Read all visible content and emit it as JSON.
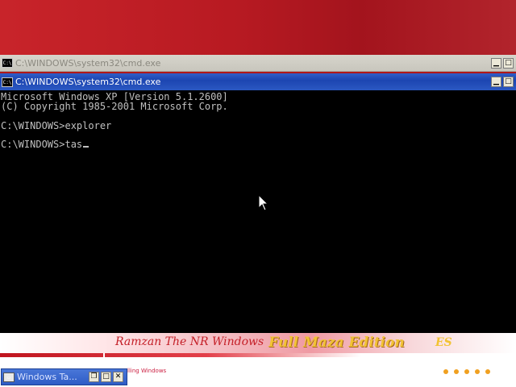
{
  "windows": {
    "background": {
      "title": "C:\\WINDOWS\\system32\\cmd.exe",
      "icon": "console-icon"
    },
    "active": {
      "title": "C:\\WINDOWS\\system32\\cmd.exe",
      "icon": "console-icon"
    }
  },
  "console": {
    "lines": [
      "Microsoft Windows XP [Version 5.1.2600]",
      "(C) Copyright 1985-2001 Microsoft Corp.",
      "",
      "C:\\WINDOWS>explorer",
      "",
      "C:\\WINDOWS>tas"
    ]
  },
  "banner": {
    "title": "Ramzan  The NR  Windows",
    "edition": "Full Maza Edition",
    "tail": "ES",
    "status": "lling Windows"
  },
  "taskbar": {
    "minimized_title": "Windows Ta..."
  },
  "colors": {
    "active_titlebar": "#1c45b1",
    "console_bg": "#000000",
    "console_text": "#c0c0c0",
    "wallpaper": "#b01818"
  }
}
